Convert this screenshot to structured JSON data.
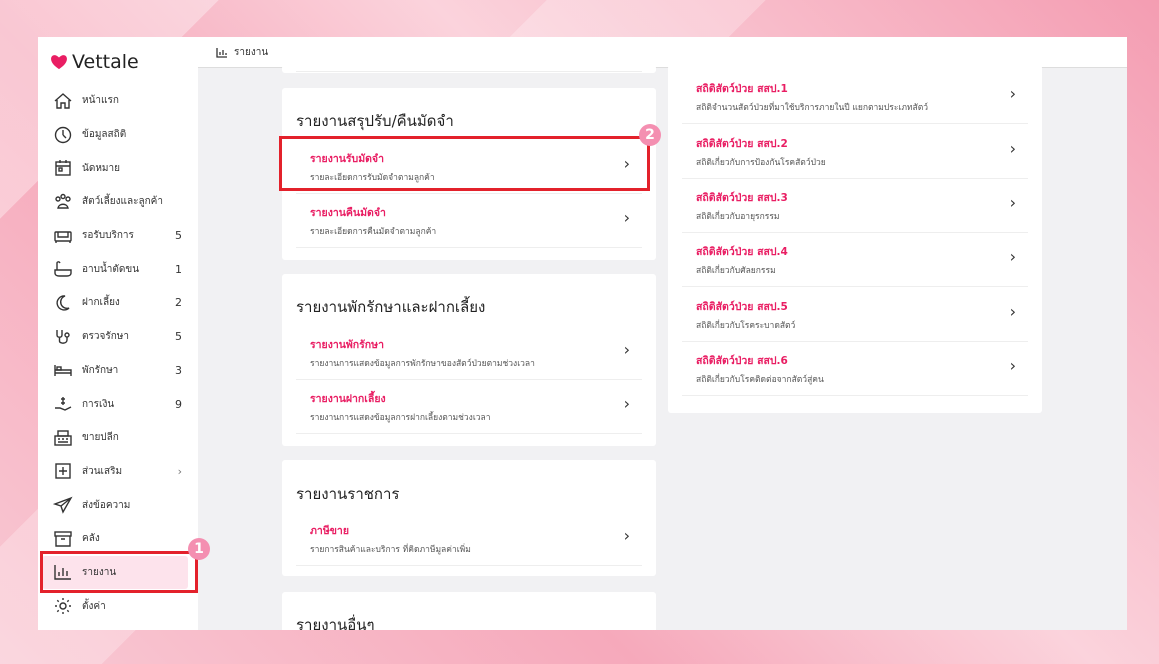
{
  "app": {
    "logo": "Vettale",
    "brand_color": "#e91e63"
  },
  "breadcrumb": {
    "label": "รายงาน"
  },
  "sidebar": {
    "items": [
      {
        "name": "home",
        "label": "หน้าแรก",
        "count": ""
      },
      {
        "name": "statistics",
        "label": "ข้อมูลสถิติ",
        "count": ""
      },
      {
        "name": "appointments",
        "label": "นัดหมาย",
        "count": ""
      },
      {
        "name": "pets-customers",
        "label": "สัตว์เลี้ยงและลูกค้า",
        "count": ""
      },
      {
        "name": "waiting-service",
        "label": "รอรับบริการ",
        "count": "5"
      },
      {
        "name": "grooming",
        "label": "อาบน้ำตัดขน",
        "count": "1"
      },
      {
        "name": "boarding",
        "label": "ฝากเลี้ยง",
        "count": "2"
      },
      {
        "name": "examination",
        "label": "ตรวจรักษา",
        "count": "5"
      },
      {
        "name": "hospitalization",
        "label": "พักรักษา",
        "count": "3"
      },
      {
        "name": "finance",
        "label": "การเงิน",
        "count": "9"
      },
      {
        "name": "retail",
        "label": "ขายปลีก",
        "count": ""
      },
      {
        "name": "addons",
        "label": "ส่วนเสริม",
        "count": ""
      },
      {
        "name": "send-message",
        "label": "ส่งข้อความ",
        "count": ""
      },
      {
        "name": "warehouse",
        "label": "คลัง",
        "count": ""
      },
      {
        "name": "reports",
        "label": "รายงาน",
        "count": ""
      },
      {
        "name": "settings",
        "label": "ตั้งค่า",
        "count": ""
      }
    ]
  },
  "callouts": {
    "one": "1",
    "two": "2"
  },
  "deposit": {
    "title": "รายงานสรุปรับ/คืนมัดจำ",
    "items": [
      {
        "title": "รายงานรับมัดจำ",
        "subtitle": "รายละเอียดการรับมัดจำตามลูกค้า"
      },
      {
        "title": "รายงานคืนมัดจำ",
        "subtitle": "รายละเอียดการคืนมัดจำตามลูกค้า"
      }
    ]
  },
  "boarding": {
    "title": "รายงานพักรักษาและฝากเลี้ยง",
    "items": [
      {
        "title": "รายงานพักรักษา",
        "subtitle": "รายงานการแสดงข้อมูลการพักรักษาของสัตว์ป่วยตามช่วงเวลา"
      },
      {
        "title": "รายงานฝากเลี้ยง",
        "subtitle": "รายงานการแสดงข้อมูลการฝากเลี้ยงตามช่วงเวลา"
      }
    ]
  },
  "gov": {
    "title": "รายงานราชการ",
    "items": [
      {
        "title": "ภาษีขาย",
        "subtitle": "รายการสินค้าและบริการ ที่คิดภาษีมูลค่าเพิ่ม"
      }
    ]
  },
  "other": {
    "title": "รายงานอื่นๆ"
  },
  "stats": {
    "items": [
      {
        "title": "สถิติสัตว์ป่วย สสป.1",
        "subtitle": "สถิติจำนวนสัตว์ป่วยที่มาใช้บริการภายในปี แยกตามประเภทสัตว์"
      },
      {
        "title": "สถิติสัตว์ป่วย สสป.2",
        "subtitle": "สถิติเกี่ยวกับการป้องกันโรคสัตว์ป่วย"
      },
      {
        "title": "สถิติสัตว์ป่วย สสป.3",
        "subtitle": "สถิติเกี่ยวกับอายุรกรรม"
      },
      {
        "title": "สถิติสัตว์ป่วย สสป.4",
        "subtitle": "สถิติเกี่ยวกับศัลยกรรม"
      },
      {
        "title": "สถิติสัตว์ป่วย สสป.5",
        "subtitle": "สถิติเกี่ยวกับโรคระบาดสัตว์"
      },
      {
        "title": "สถิติสัตว์ป่วย สสป.6",
        "subtitle": "สถิติเกี่ยวกับโรคติดต่อจากสัตว์สู่คน"
      }
    ]
  }
}
